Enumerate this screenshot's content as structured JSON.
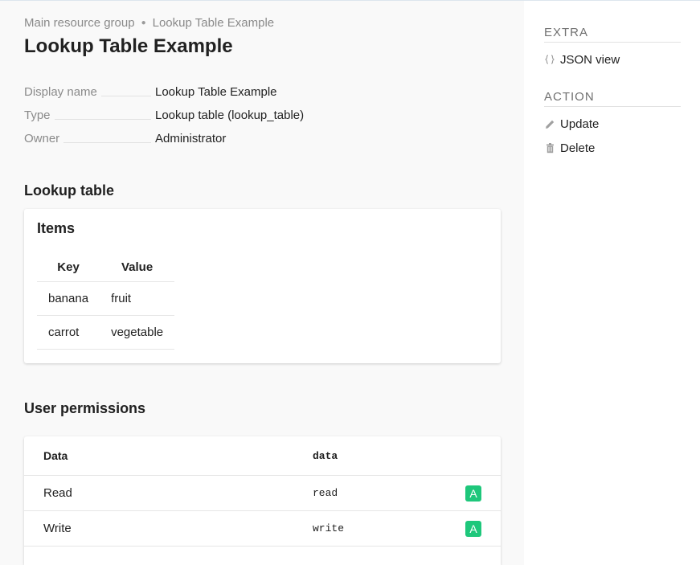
{
  "breadcrumb": {
    "group": "Main resource group",
    "current": "Lookup Table Example"
  },
  "page": {
    "title": "Lookup Table Example"
  },
  "properties": [
    {
      "label": "Display name",
      "value": "Lookup Table Example"
    },
    {
      "label": "Type",
      "value": "Lookup table (lookup_table)"
    },
    {
      "label": "Owner",
      "value": "Administrator"
    }
  ],
  "lookup": {
    "heading": "Lookup table",
    "card_title": "Items",
    "columns": {
      "key": "Key",
      "value": "Value"
    },
    "rows": [
      {
        "key": "banana",
        "value": "fruit"
      },
      {
        "key": "carrot",
        "value": "vegetable"
      }
    ]
  },
  "permissions": {
    "heading": "User permissions",
    "header": {
      "name": "Data",
      "code": "data"
    },
    "rows": [
      {
        "name": "Read",
        "code": "read",
        "badge": "A"
      },
      {
        "name": "Write",
        "code": "write",
        "badge": "A"
      }
    ]
  },
  "sidebar": {
    "extra_heading": "EXTRA",
    "json_view": "JSON view",
    "action_heading": "ACTION",
    "update": "Update",
    "delete": "Delete"
  },
  "colors": {
    "badge": "#1ec77b",
    "muted_text": "#8a8a8a",
    "main_bg": "#f9f9f9"
  },
  "icons": {
    "json": "braces-icon",
    "update": "pencil-icon",
    "delete": "trash-icon",
    "breadcrumb_sep": "bullet-icon"
  }
}
